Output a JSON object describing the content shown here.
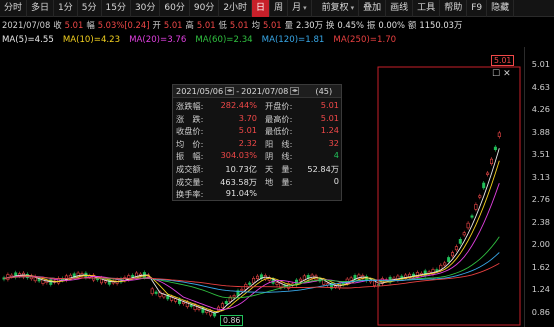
{
  "toolbar": {
    "periods": [
      "分时",
      "多日",
      "1分",
      "5分",
      "15分",
      "30分",
      "60分",
      "90分",
      "2小时",
      "日",
      "周",
      "月"
    ],
    "selected_period": "日",
    "actions": [
      "前复权",
      "叠加",
      "画线",
      "工具",
      "帮助",
      "F9",
      "隐藏"
    ]
  },
  "stats": {
    "date": "2021/07/08",
    "close_label": "收",
    "close": "5.01",
    "change_label": "幅",
    "change": "5.03%[0.24]",
    "open_label": "开",
    "open": "5.01",
    "high_label": "高",
    "high": "5.01",
    "low_label": "低",
    "low": "5.01",
    "avg_label": "均",
    "avg": "5.01",
    "volume_label": "量",
    "volume": "2.30万",
    "turnover_label": "换",
    "turnover": "0.45%",
    "amplitude_label": "振",
    "amplitude": "0.00%",
    "amount_label": "额",
    "amount": "1150.03万"
  },
  "ma": [
    {
      "label": "MA(5)=4.55",
      "color": "#e8e8e8"
    },
    {
      "label": "MA(10)=4.23",
      "color": "#f2d020"
    },
    {
      "label": "MA(20)=3.76",
      "color": "#e040e0"
    },
    {
      "label": "MA(60)=2.34",
      "color": "#30c040"
    },
    {
      "label": "MA(120)=1.81",
      "color": "#38a8e8"
    },
    {
      "label": "MA(250)=1.70",
      "color": "#e84040"
    }
  ],
  "axis": {
    "labels": [
      "5.01",
      "4.63",
      "4.26",
      "3.88",
      "3.51",
      "3.13",
      "2.76",
      "2.38",
      "2.00",
      "1.62",
      "1.24",
      "0.86"
    ]
  },
  "info_box": {
    "start_date": "2021/05/06",
    "separator": "-",
    "end_date": "2021/07/08",
    "count": "(45)",
    "rows": [
      {
        "k1": "涨跌幅:",
        "v1": "282.44%",
        "c1": "red",
        "k2": "开盘价:",
        "v2": "5.01",
        "c2": "red"
      },
      {
        "k1": "涨　跌:",
        "v1": "3.70",
        "c1": "red",
        "k2": "最高价:",
        "v2": "5.01",
        "c2": "red"
      },
      {
        "k1": "收盘价:",
        "v1": "5.01",
        "c1": "red",
        "k2": "最低价:",
        "v2": "1.24",
        "c2": "red"
      },
      {
        "k1": "均　价:",
        "v1": "2.32",
        "c1": "red",
        "k2": "阳　线:",
        "v2": "32",
        "c2": "red"
      },
      {
        "k1": "振　幅:",
        "v1": "304.03%",
        "c1": "red",
        "k2": "阴　线:",
        "v2": "4",
        "c2": "green"
      },
      {
        "k1": "成交额:",
        "v1": "10.73亿",
        "c1": "white",
        "k2": "天　量:",
        "v2": "52.84万",
        "c2": "white"
      },
      {
        "k1": "成交量:",
        "v1": "463.58万",
        "c1": "white",
        "k2": "地　量:",
        "v2": "0",
        "c2": "white"
      },
      {
        "k1": "换手率:",
        "v1": "91.04%",
        "c1": "white",
        "k2": "",
        "v2": "",
        "c2": "white"
      }
    ]
  },
  "markers": {
    "low": "0.86",
    "high": "5.01"
  },
  "colors": {
    "up": "#f04848",
    "down": "#22c05a",
    "selection_box": "#c8202a"
  }
}
